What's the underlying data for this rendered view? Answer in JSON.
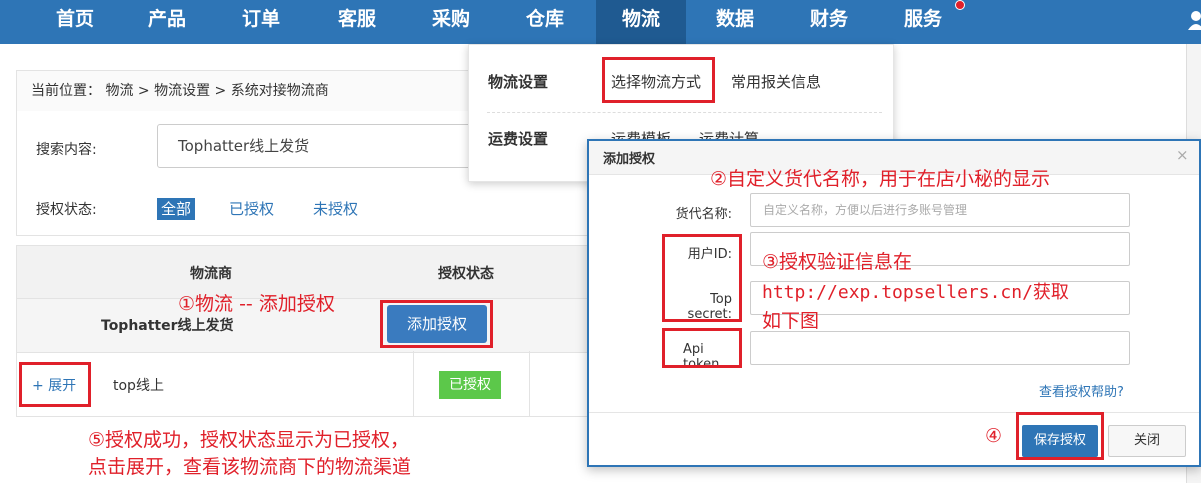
{
  "nav": {
    "items": [
      {
        "label": "首页"
      },
      {
        "label": "产品"
      },
      {
        "label": "订单"
      },
      {
        "label": "客服"
      },
      {
        "label": "采购"
      },
      {
        "label": "仓库"
      },
      {
        "label": "物流",
        "active": true
      },
      {
        "label": "数据"
      },
      {
        "label": "财务"
      },
      {
        "label": "服务"
      }
    ],
    "active_color": "#1f5a91",
    "bar_color": "#2e75b6"
  },
  "breadcrumb": "当前位置： 物流 > 物流设置 > 系统对接物流商",
  "search": {
    "label": "搜索内容:",
    "value": "Tophatter线上发货"
  },
  "auth_filter": {
    "label": "授权状态:",
    "options": [
      "全部",
      "已授权",
      "未授权"
    ],
    "selected": "全部"
  },
  "table": {
    "headers": [
      "物流商",
      "授权状态"
    ],
    "group": {
      "name": "Tophatter线上发货",
      "action": "添加授权"
    },
    "row": {
      "expand": "+ 展开",
      "name": "top线上",
      "status": "已授权"
    }
  },
  "dropdown": {
    "sections": [
      {
        "title": "物流设置",
        "items": [
          "选择物流方式",
          "常用报关信息"
        ]
      },
      {
        "title": "运费设置",
        "items": [
          "运费模板",
          "运费计算"
        ]
      }
    ]
  },
  "modal": {
    "title": "添加授权",
    "close": "×",
    "fields": [
      {
        "label": "货代名称:",
        "placeholder": "自定义名称，方便以后进行多账号管理"
      },
      {
        "label": "用户ID:",
        "placeholder": ""
      },
      {
        "label": "Top secret:",
        "placeholder": ""
      },
      {
        "label": "Api token",
        "placeholder": ""
      }
    ],
    "help_link": "查看授权帮助?",
    "save": "保存授权",
    "cancel": "关闭"
  },
  "annotations": {
    "a1": "①物流 -- 添加授权",
    "a2": "②自定义货代名称，用于在店小秘的显示",
    "a3_line1": "③授权验证信息在",
    "a3_line2": "http://exp.topsellers.cn/获取",
    "a3_line3": "如下图",
    "a4": "④",
    "a5_line1": "⑤授权成功，授权状态显示为已授权，",
    "a5_line2": "点击展开，查看该物流商下的物流渠道"
  },
  "colors": {
    "primary": "#2e75b6",
    "annotation_red": "#e0202a",
    "success": "#5cc84a"
  }
}
